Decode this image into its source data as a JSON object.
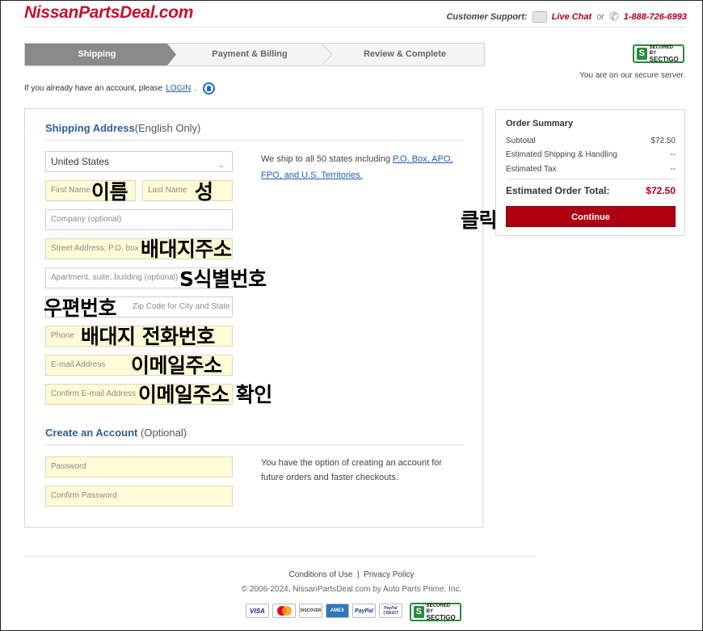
{
  "header": {
    "logo": "NissanPartsDeal.com",
    "support_label": "Customer Support:",
    "live_chat": "Live Chat",
    "or": "or",
    "phone": "1-888-726-6993"
  },
  "steps": [
    "Shipping",
    "Payment & Billing",
    "Review & Complete"
  ],
  "security": {
    "badge_top": "SECURED BY",
    "badge_brand": "SECTIGO",
    "secure_text": "You are on our secure server."
  },
  "login": {
    "prompt": "If you already have an account, please",
    "link": "LOGIN",
    "suffix": "."
  },
  "shipping": {
    "title": "Shipping Address",
    "subtitle": "(English Only)",
    "country": "United States",
    "placeholders": {
      "first_name": "First Name",
      "last_name": "Last Name",
      "company": "Company (optional)",
      "street": "Street Address, P.O. box",
      "apartment": "Apartment, suite, building (optional)",
      "zip": "Zip Code for City and State",
      "phone": "Phone",
      "email": "E-mail Address",
      "confirm_email": "Confirm E-mail Address"
    },
    "note_prefix": "We ship to all 50 states including",
    "note_link": "P.O. Box, APO, FPO, and U.S. Territories."
  },
  "account": {
    "title": "Create an Account",
    "subtitle": "(Optional)",
    "password": "Password",
    "confirm_password": "Confirm Password",
    "note": "You have the option of creating an account for future orders and faster checkouts."
  },
  "annotations": {
    "first_name": "이름",
    "last_name": "성",
    "street": "배대지주소",
    "apartment": "S식별번호",
    "zip": "우편번호",
    "phone": "배대지 전화번호",
    "email": "이메일주소",
    "confirm_email": "이메일주소 확인",
    "click": "클릭"
  },
  "summary": {
    "title": "Order Summary",
    "rows": [
      {
        "label": "Subtotal",
        "value": "$72.50"
      },
      {
        "label": "Estimated Shipping & Handling",
        "value": "--"
      },
      {
        "label": "Estimated Tax",
        "value": "--"
      }
    ],
    "total_label": "Estimated Order Total:",
    "total_value": "$72.50",
    "continue": "Continue"
  },
  "footer": {
    "conditions": "Conditions of Use",
    "separator": "|",
    "privacy": "Privacy Policy",
    "copyright": "© 2006-2024, NissanPartsDeal.com by Auto Parts Prime, Inc.",
    "cards": [
      "VISA",
      "MC",
      "DISCOVER",
      "AMEX",
      "PayPal",
      "PayPal CREDIT"
    ]
  },
  "colors": {
    "brand_red": "#c8102e",
    "button_red": "#b0000f",
    "link_blue": "#1f5fa8",
    "field_yellow": "#fffbd6",
    "sectigo_green": "#2b8a3e"
  }
}
